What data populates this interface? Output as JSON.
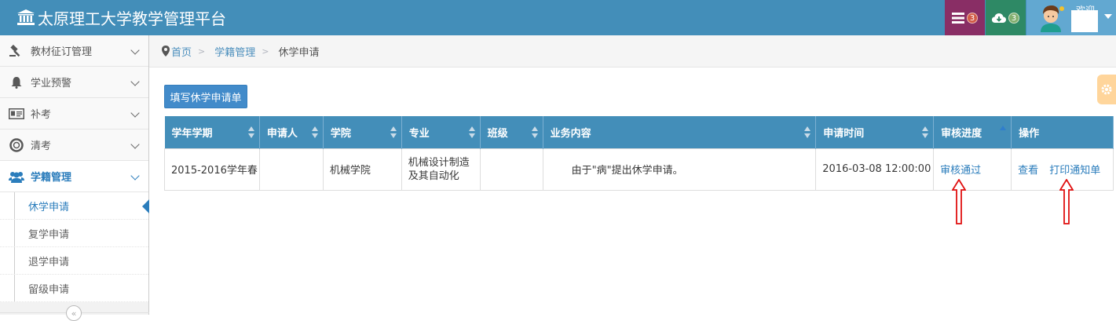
{
  "app": {
    "title": "太原理工大学教学管理平台"
  },
  "header": {
    "tasks_badge": "3",
    "cloud_badge": "3",
    "welcome": "欢迎"
  },
  "sidebar": {
    "items": [
      {
        "label": "教材征订管理",
        "icon": "gavel-icon"
      },
      {
        "label": "学业预警",
        "icon": "bell-icon"
      },
      {
        "label": "补考",
        "icon": "id-card-icon"
      },
      {
        "label": "清考",
        "icon": "life-ring-icon"
      },
      {
        "label": "学籍管理",
        "icon": "users-icon"
      }
    ],
    "submenu": [
      {
        "label": "休学申请"
      },
      {
        "label": "复学申请"
      },
      {
        "label": "退学申请"
      },
      {
        "label": "留级申请"
      }
    ]
  },
  "breadcrumb": {
    "home": "首页",
    "section": "学籍管理",
    "current": "休学申请"
  },
  "actions": {
    "fill_form": "填写休学申请单"
  },
  "table": {
    "columns": [
      "学年学期",
      "申请人",
      "学院",
      "专业",
      "班级",
      "业务内容",
      "申请时间",
      "审核进度",
      "操作"
    ],
    "rows": [
      {
        "term": "2015-2016学年春",
        "applicant": "",
        "college": "机械学院",
        "major": "机械设计制造及其自动化",
        "class": "",
        "content": "由于\"病\"提出休学申请。",
        "time": "2016-03-08 12:00:00",
        "status": "审核通过",
        "view": "查看",
        "print": "打印通知单"
      }
    ]
  },
  "colors": {
    "header": "#438eb9",
    "accent": "#2b7dbc",
    "annotation": "#e01010"
  }
}
